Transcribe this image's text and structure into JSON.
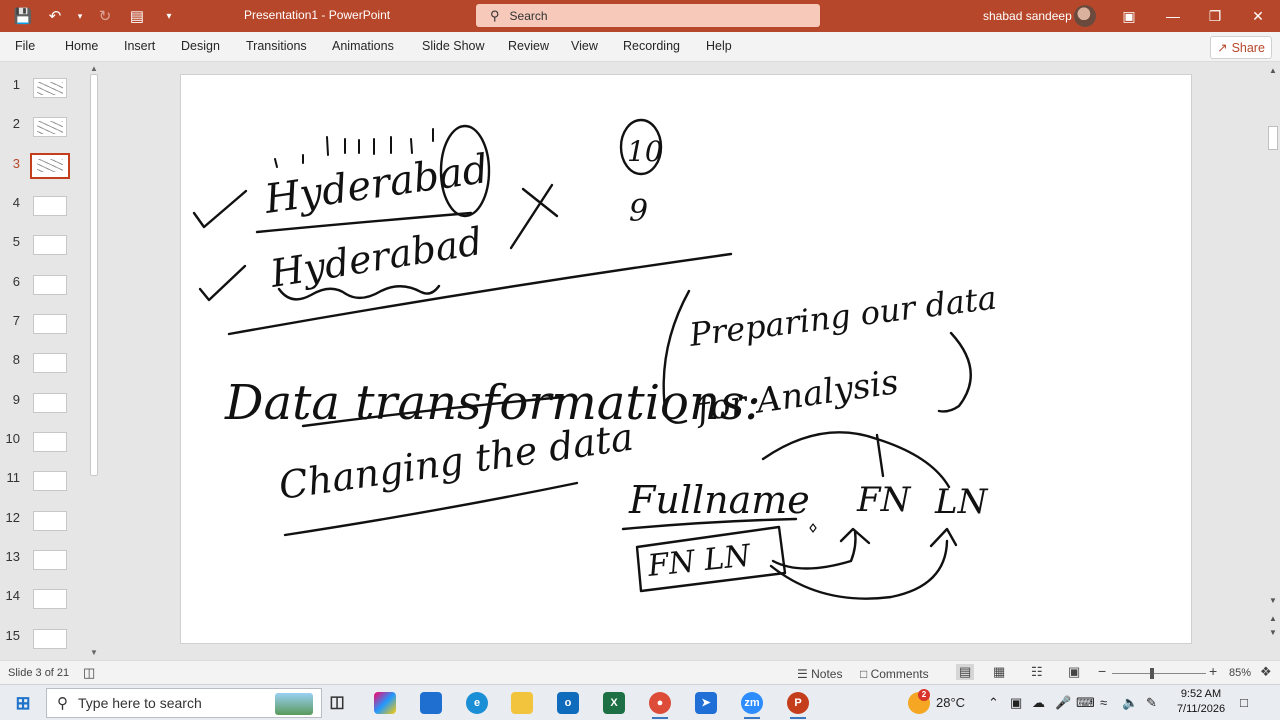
{
  "titlebar": {
    "doc_title": "Presentation1  -  PowerPoint",
    "search_placeholder": "Search",
    "user_name": "shabad sandeep",
    "icons": [
      "save-icon",
      "undo-icon",
      "redo-icon",
      "present-icon",
      "customize-icon"
    ]
  },
  "ribbon": {
    "tabs": [
      "File",
      "Home",
      "Insert",
      "Design",
      "Transitions",
      "Animations",
      "Slide Show",
      "Review",
      "View",
      "Recording",
      "Help"
    ],
    "share_label": "Share"
  },
  "thumbnails": {
    "numbers": [
      "1",
      "2",
      "3",
      "4",
      "5",
      "6",
      "7",
      "8",
      "9",
      "10",
      "11",
      "12",
      "13",
      "14",
      "15"
    ],
    "active": "3"
  },
  "slide": {
    "handwriting": {
      "line1": "Hyderabad",
      "line2": "Hyderabad",
      "circled_number": "10",
      "number_below": "9",
      "heading": "Data transformations:",
      "paren_line1": "Preparing our data",
      "paren_line2": "for Analysis",
      "subheading": "Changing the data",
      "fullname": "Fullname",
      "fn_ln_box": "FN LN",
      "fn": "FN",
      "ln": "LN"
    }
  },
  "statusbar": {
    "slide_info": "Slide 3 of 21",
    "notes_label": "Notes",
    "comments_label": "Comments",
    "zoom": "85%"
  },
  "taskbar": {
    "search_placeholder": "Type here to search",
    "weather": "28°C",
    "weather_badge": "2",
    "time": "9:52 AM",
    "date": "7/11/2026"
  }
}
